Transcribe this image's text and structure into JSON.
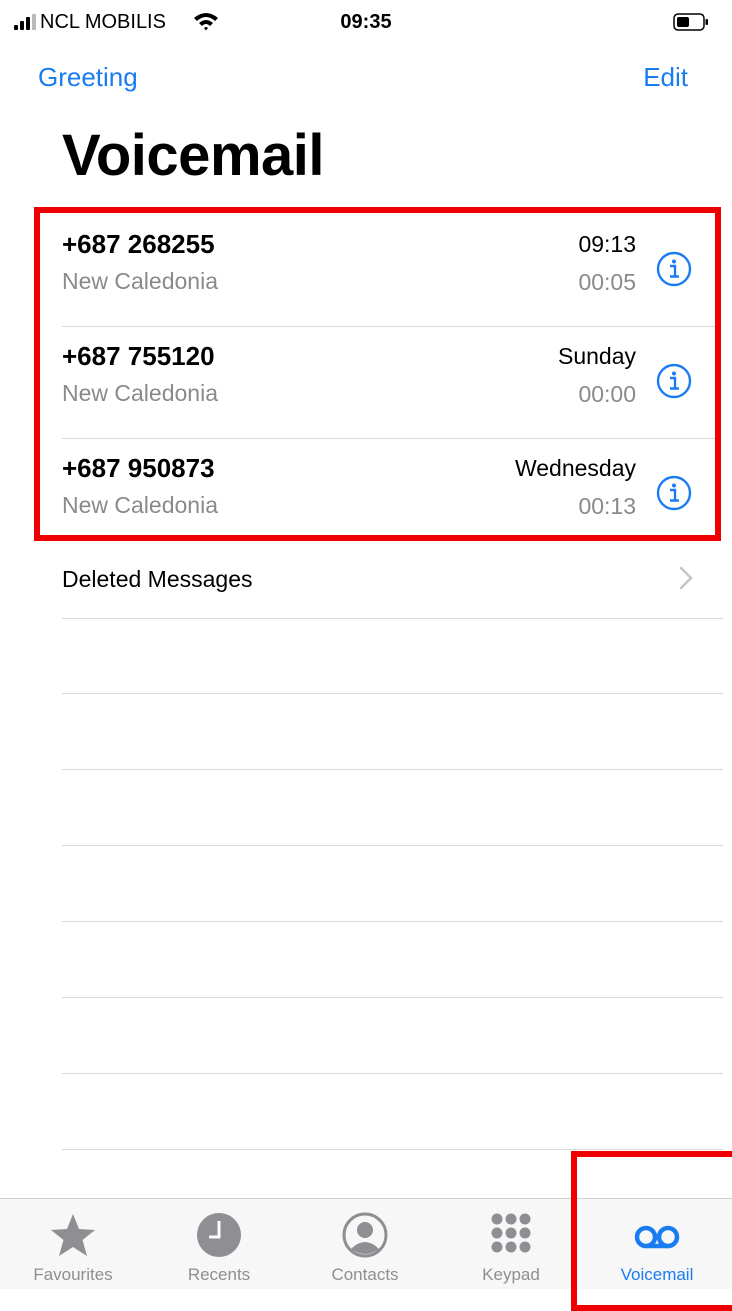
{
  "status_bar": {
    "carrier": "NCL MOBILIS",
    "time": "09:35"
  },
  "nav": {
    "left": "Greeting",
    "right": "Edit"
  },
  "title": "Voicemail",
  "voicemails": [
    {
      "number": "+687 268255",
      "location": "New Caledonia",
      "when": "09:13",
      "duration": "00:05"
    },
    {
      "number": "+687 755120",
      "location": "New Caledonia",
      "when": "Sunday",
      "duration": "00:00"
    },
    {
      "number": "+687 950873",
      "location": "New Caledonia",
      "when": "Wednesday",
      "duration": "00:13"
    }
  ],
  "deleted_messages": "Deleted Messages",
  "tabs": [
    {
      "label": "Favourites",
      "icon": "star-icon"
    },
    {
      "label": "Recents",
      "icon": "clock-icon"
    },
    {
      "label": "Contacts",
      "icon": "person-circle-icon"
    },
    {
      "label": "Keypad",
      "icon": "keypad-icon"
    },
    {
      "label": "Voicemail",
      "icon": "voicemail-icon",
      "active": true
    }
  ],
  "colors": {
    "accent": "#1a7cf2",
    "highlight": "#ee0000",
    "secondary_text": "#8a8a8e",
    "inactive_tab": "#8e8e93"
  }
}
